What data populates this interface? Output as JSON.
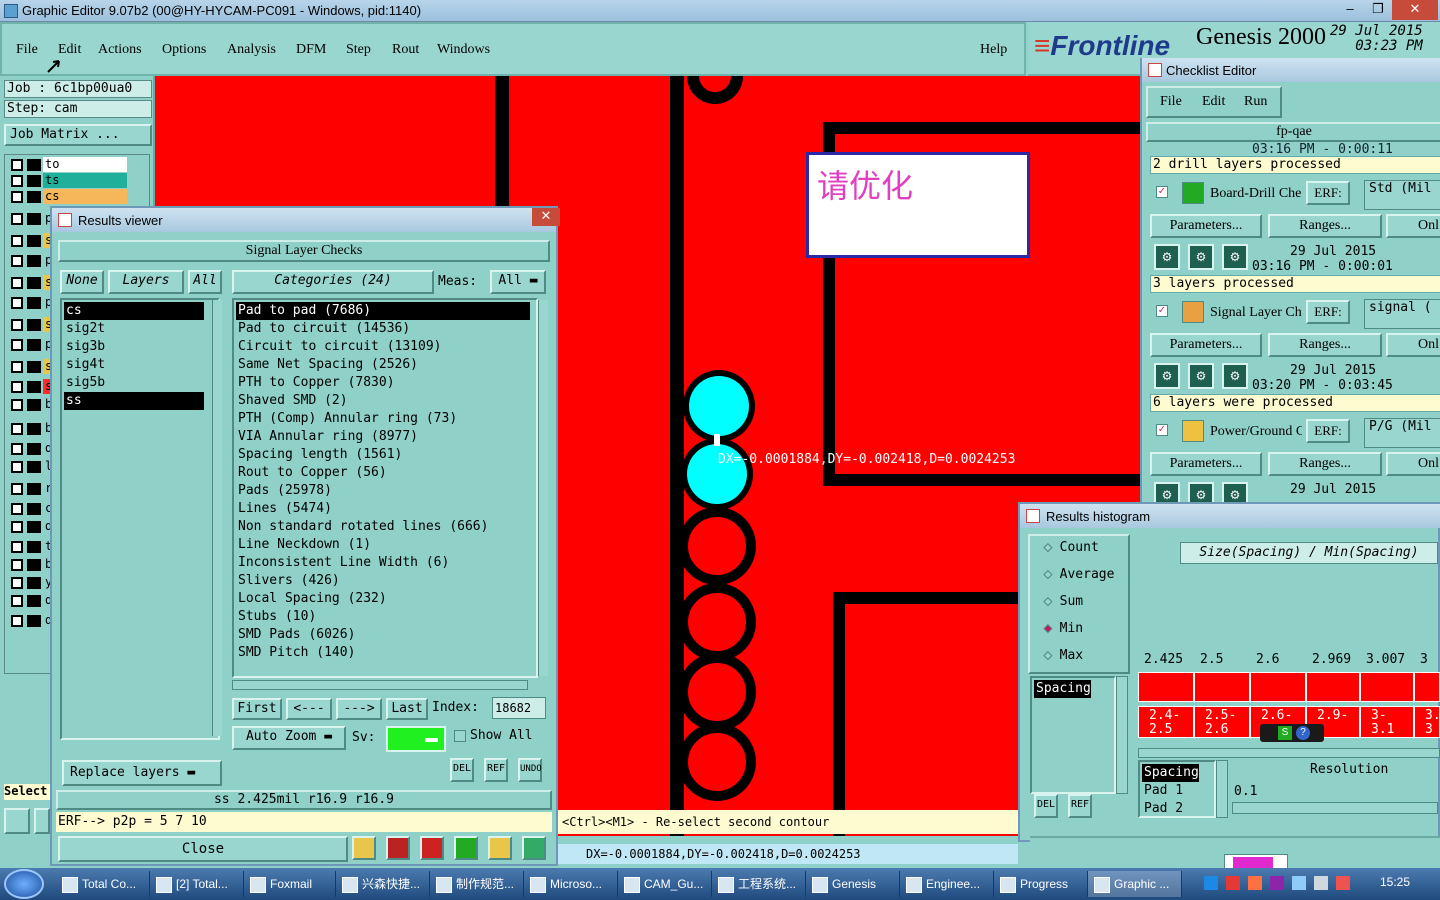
{
  "window": {
    "title": "Graphic Editor 9.07b2 (00@HY-HYCAM-PC091 - Windows, pid:1140)",
    "minimize": "–",
    "restore": "❐",
    "close": "✕"
  },
  "menubar": {
    "items": [
      "File",
      "Edit",
      "Actions",
      "Options",
      "Analysis",
      "DFM",
      "Step",
      "Rout",
      "Windows"
    ],
    "help": "Help"
  },
  "brand": {
    "logo": "Frontline",
    "product": "Genesis 2000",
    "date": "29 Jul 2015",
    "time": "03:23 PM"
  },
  "job": {
    "job_line": "Job : 6c1bp00ua0",
    "step_line": "Step: cam",
    "matrix_button": "Job Matrix ..."
  },
  "layers": {
    "top": [
      {
        "name": "to",
        "color": "#ffffff"
      },
      {
        "name": "ts",
        "color": "#20b09a"
      },
      {
        "name": "cs",
        "color": "#f6b65a"
      }
    ],
    "rows": [
      {
        "name": "p",
        "color": "#8fd0c8"
      },
      {
        "name": "s",
        "color": "#e8c64a"
      },
      {
        "name": "p",
        "color": "#8fd0c8"
      },
      {
        "name": "s",
        "color": "#e8c64a"
      },
      {
        "name": "p",
        "color": "#8fd0c8"
      },
      {
        "name": "s",
        "color": "#e8c64a"
      },
      {
        "name": "p",
        "color": "#8fd0c8"
      },
      {
        "name": "s",
        "color": "#e8c64a"
      },
      {
        "name": "s",
        "color": "#ff2a2a"
      },
      {
        "name": "b",
        "color": "#8fd0c8"
      },
      {
        "name": "b",
        "color": "#8fd0c8"
      },
      {
        "name": "d",
        "color": "#8fd0c8"
      },
      {
        "name": "l",
        "color": "#8fd0c8"
      },
      {
        "name": "r",
        "color": "#8fd0c8"
      },
      {
        "name": "c",
        "color": "#8fd0c8"
      },
      {
        "name": "d",
        "color": "#8fd0c8"
      },
      {
        "name": "t",
        "color": "#8fd0c8"
      },
      {
        "name": "b",
        "color": "#8fd0c8"
      },
      {
        "name": "y",
        "color": "#8fd0c8"
      },
      {
        "name": "d",
        "color": "#8fd0c8"
      },
      {
        "name": "d",
        "color": "#8fd0c8"
      }
    ],
    "select_label": "Select"
  },
  "canvas": {
    "note": "请优化",
    "measure": "DX=-0.0001884,DY=-0.002418,D=0.0024253"
  },
  "results_viewer": {
    "title": "Results viewer",
    "close_x": "✕",
    "header": "Signal Layer Checks",
    "none_btn": "None",
    "layers_btn": "Layers",
    "all_btn": "All",
    "layer_items": [
      "cs",
      "sig2t",
      "sig3b",
      "sig4t",
      "sig5b",
      "ss"
    ],
    "categories_btn": "Categories (24)",
    "meas_label": "Meas:",
    "meas_value": "All",
    "categories": [
      "Pad to pad (7686)",
      "Pad to circuit (14536)",
      "Circuit to circuit (13109)",
      "Same Net Spacing (2526)",
      "PTH to Copper (7830)",
      "Shaved SMD (2)",
      "PTH (Comp) Annular ring (73)",
      "VIA Annular ring (8977)",
      "Spacing length (1561)",
      "Rout to Copper (56)",
      "Pads (25978)",
      "Lines (5474)",
      "Non standard rotated lines (666)",
      "Line Neckdown (1)",
      "Inconsistent Line Width (6)",
      "Slivers (426)",
      "Local Spacing (232)",
      "Stubs (10)",
      "SMD Pads (6026)",
      "SMD Pitch (140)"
    ],
    "first_btn": "First",
    "prev_btn": "<---",
    "next_btn": "--->",
    "last_btn": "Last",
    "index_label": "Index:",
    "index_value": "18682",
    "autozoom_btn": "Auto Zoom",
    "sv_label": "Sv:",
    "showall_label": "Show All",
    "replace_btn": "Replace layers",
    "del_icon": "DEL",
    "ref_icon": "REF",
    "undo_icon": "UNDO",
    "status_line": "ss 2.425mil  r16.9  r16.9",
    "erf_line": "ERF--> p2p = 5 7 10",
    "close_btn": "Close"
  },
  "checklist": {
    "title": "Checklist Editor",
    "menu": [
      "File",
      "Edit",
      "Run"
    ],
    "name": "fp-qae",
    "top_time": "03:16 PM - 0:00:11",
    "actions": [
      {
        "status": "2 drill layers processed",
        "name": "Board-Drill Che",
        "erf_label": "ERF:",
        "erf": "Std (Mil",
        "params": "Parameters...",
        "ranges": "Ranges...",
        "only": "Onl",
        "date": "29 Jul 2015",
        "time": "03:16 PM - 0:00:01"
      },
      {
        "status": "3 layers processed",
        "name": "Signal Layer Ch",
        "erf_label": "ERF:",
        "erf": "signal (",
        "params": "Parameters...",
        "ranges": "Ranges...",
        "only": "Onl",
        "date": "29 Jul 2015",
        "time": "03:20 PM - 0:03:45"
      },
      {
        "status": "6 layers were processed",
        "name": "Power/Ground C",
        "erf_label": "ERF:",
        "erf": "P/G (Mil",
        "params": "Parameters...",
        "ranges": "Ranges...",
        "only": "Onl",
        "date": "29 Jul 2015",
        "time": ""
      }
    ]
  },
  "histogram": {
    "title": "Results histogram",
    "modes": [
      "Count",
      "Average",
      "Sum",
      "Min",
      "Max"
    ],
    "selected_mode": "Min",
    "header": "Size(Spacing) / Min(Spacing)",
    "list_item": "Spacing",
    "top_values": [
      "2.425",
      "2.5",
      "2.6",
      "2.969",
      "3.007",
      "3"
    ],
    "ranges": [
      "2.4-\n2.5",
      "2.5-\n2.6",
      "2.6-",
      "2.9-",
      "3-\n3.1",
      "3.\n3"
    ],
    "del_icon": "DEL",
    "ref_icon": "REF",
    "bottom_list": [
      "Spacing",
      "Pad 1",
      "Pad 2"
    ],
    "resolution_label": "Resolution",
    "resolution_value": "0.1"
  },
  "hint": "<Ctrl><M1> - Re-select second contour",
  "coord": "DX=-0.0001884,DY=-0.002418,D=0.0024253",
  "taskbar": {
    "tasks": [
      "Total Co...",
      "[2] Total...",
      "Foxmail",
      "兴森快捷...",
      "制作规范...",
      "Microso...",
      "CAM_Gu...",
      "工程系统...",
      "Genesis",
      "Enginee...",
      "Progress",
      "Graphic ..."
    ],
    "clock": "15:25"
  }
}
